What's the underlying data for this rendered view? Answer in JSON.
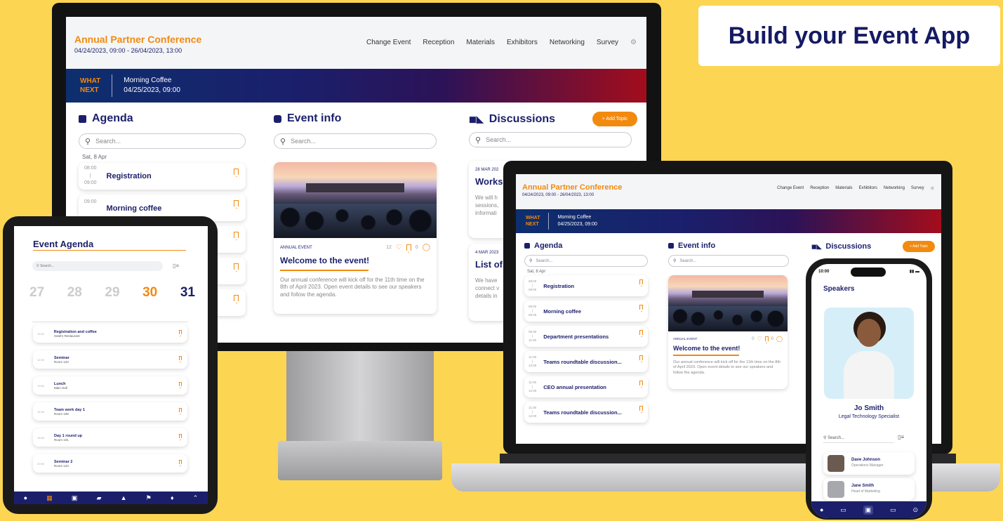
{
  "headline": "Build your Event App",
  "conference": {
    "title": "Annual Partner Conference",
    "dates": "04/24/2023, 09:00 - 26/04/2023, 13:00",
    "nav": [
      "Change Event",
      "Reception",
      "Materials",
      "Exhibitors",
      "Networking",
      "Survey"
    ],
    "what_next_line1": "WHAT",
    "what_next_line2": "NEXT",
    "next_title": "Morning Coffee",
    "next_date": "04/25/2023, 09:00",
    "agenda_title": "Agenda",
    "event_info_title": "Event info",
    "discussions_title": "Discussions",
    "add_topic": "+ Add Topic",
    "search_placeholder": "Search...",
    "day_label": "Sat, 8 Apr",
    "event_card": {
      "category": "ANNUAL EVENT",
      "likes": "12",
      "comments": "0",
      "title": "Welcome to the event!",
      "body": "Our annual conference will kick off for the 11th time on the 8th of April 2023. Open event details to see our speakers and follow the agenda."
    },
    "discussions": [
      {
        "date": "28 MAR 202",
        "title": "Works",
        "body_lines": [
          "We will h",
          "sessions,",
          "informati"
        ]
      },
      {
        "date": "4 MAR 2023",
        "title": "List of",
        "body_lines": [
          "We have",
          "connect v",
          "details in"
        ]
      }
    ]
  },
  "monitor_agenda": [
    {
      "start": "08:00",
      "end": "09:00",
      "title": "Registration"
    },
    {
      "start": "09:00",
      "end": "",
      "title": "Morning coffee"
    }
  ],
  "laptop": {
    "likes": "0",
    "comments": "0",
    "agenda": [
      {
        "start": "08:00",
        "end": "09:00",
        "title": "Registration"
      },
      {
        "start": "09:00",
        "end": "09:30",
        "title": "Morning coffee"
      },
      {
        "start": "09:30",
        "end": "11:00",
        "title": "Department presentations"
      },
      {
        "start": "11:00",
        "end": "12:00",
        "title": "Teams roundtable discussion..."
      },
      {
        "start": "11:00",
        "end": "12:00",
        "title": "CEO annual presentation"
      },
      {
        "start": "11:00",
        "end": "12:00",
        "title": "Teams roundtable discussion..."
      }
    ]
  },
  "tablet": {
    "title": "Event Agenda",
    "search_placeholder": "Search...",
    "days": [
      {
        "num": "27",
        "active": false
      },
      {
        "num": "28",
        "active": false
      },
      {
        "num": "29",
        "active": false
      },
      {
        "num": "30",
        "active": true
      },
      {
        "num": "31",
        "active": false
      }
    ],
    "items": [
      {
        "time": "11:00",
        "title": "Registration and coffee",
        "place": "Hotel's Restaurant"
      },
      {
        "time": "12:00",
        "title": "Seminar",
        "place": "Room 123"
      },
      {
        "time": "13:00",
        "title": "Lunch",
        "place": "Main Hall"
      },
      {
        "time": "14:00",
        "title": "Team work day 1",
        "place": "Room 108"
      },
      {
        "time": "15:00",
        "title": "Day 1 round up",
        "place": "Room 101"
      },
      {
        "time": "20:00",
        "title": "Seminar 2",
        "place": "Room 123"
      }
    ]
  },
  "phone": {
    "time": "10:00",
    "title": "Speakers",
    "speaker_name": "Jo Smith",
    "speaker_role": "Legal Technology Specialist",
    "search_placeholder": "Search...",
    "people": [
      {
        "name": "Dave Johnson",
        "role": "Operations Manager"
      },
      {
        "name": "Jane Smith",
        "role": "Head of Marketing"
      }
    ]
  },
  "colors": {
    "accent": "#f28a10",
    "navy": "#1b1f6b",
    "background": "#fcd553"
  }
}
